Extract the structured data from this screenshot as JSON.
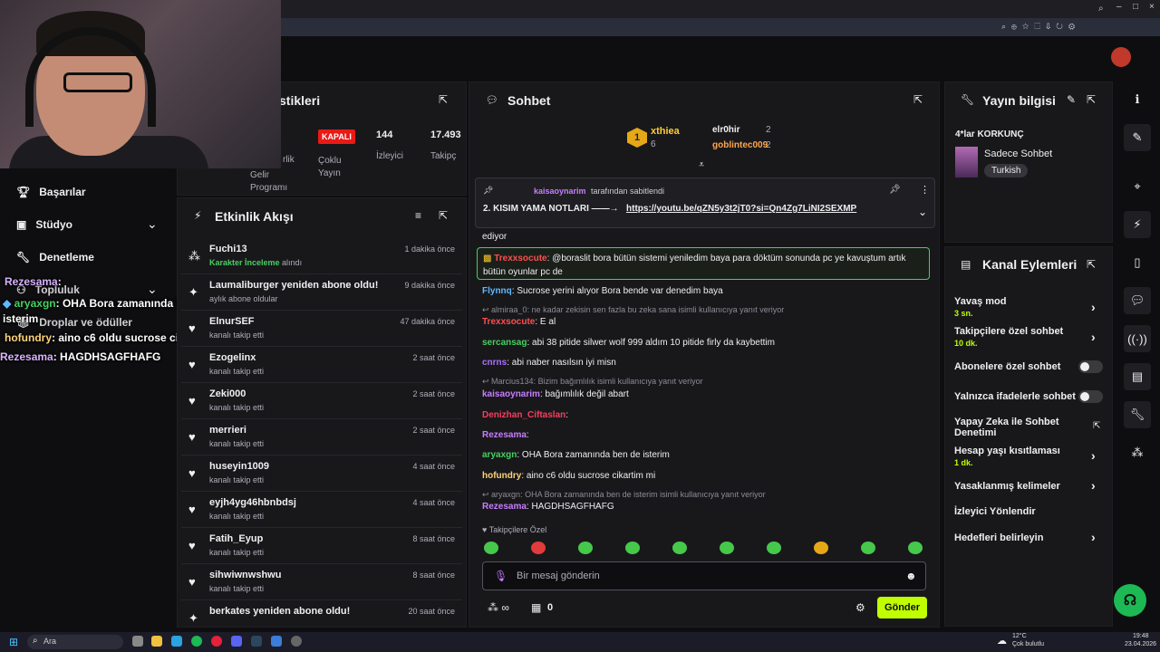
{
  "stats": {
    "title_fragment": "stikleri",
    "col1_top": "rlik",
    "col1_bottom": "Gelir Programı",
    "badge": "KAPALI",
    "multi_label": "Çoklu Yayın",
    "viewers_value": "144",
    "viewers_label": "İzleyici",
    "followers_value": "17.493",
    "followers_label": "Takipç"
  },
  "left_nav": {
    "items": [
      {
        "label": "Başarılar",
        "icon": "trophy-icon"
      },
      {
        "label": "Stüdyo",
        "icon": "studio-icon"
      },
      {
        "label": "Denetleme",
        "icon": "wrench-icon"
      },
      {
        "label": "Topluluk",
        "icon": "community-icon"
      },
      {
        "label": "Droplar ve ödüller",
        "icon": "gift-icon"
      }
    ]
  },
  "overlay_chat": [
    {
      "user": "Rezesama",
      "text": ":"
    },
    {
      "user": "aryaxgn",
      "text": ": OHA Bora zamanında ben de isterim"
    },
    {
      "user": "hofundry",
      "text": ": aino c6 oldu sucrose cikartim mi"
    },
    {
      "user": "Rezesama",
      "text": ": HAGDHSAGFHAFG"
    }
  ],
  "activity": {
    "title": "Etkinlik Akışı",
    "items": [
      {
        "name": "Fuchi13",
        "sub_green": "Karakter İnceleme",
        "sub": " alındı",
        "time": "1 dakika önce",
        "icon": "points-icon"
      },
      {
        "name": "Laumaliburger yeniden abone oldu!",
        "sub": "aylık abone oldular",
        "time": "9 dakika önce",
        "icon": "star-icon"
      },
      {
        "name": "ElnurSEF",
        "sub": "kanalı takip etti",
        "time": "47 dakika önce",
        "icon": "heart-icon"
      },
      {
        "name": "Ezogelinx",
        "sub": "kanalı takip etti",
        "time": "2 saat önce",
        "icon": "heart-icon"
      },
      {
        "name": "Zeki000",
        "sub": "kanalı takip etti",
        "time": "2 saat önce",
        "icon": "heart-icon"
      },
      {
        "name": "merrieri",
        "sub": "kanalı takip etti",
        "time": "2 saat önce",
        "icon": "heart-icon"
      },
      {
        "name": "huseyin1009",
        "sub": "kanalı takip etti",
        "time": "4 saat önce",
        "icon": "heart-icon"
      },
      {
        "name": "eyjh4yg46hbnbdsj",
        "sub": "kanalı takip etti",
        "time": "4 saat önce",
        "icon": "heart-icon"
      },
      {
        "name": "Fatih_Eyup",
        "sub": "kanalı takip etti",
        "time": "8 saat önce",
        "icon": "heart-icon"
      },
      {
        "name": "sihwiwnwshwu",
        "sub": "kanalı takip etti",
        "time": "8 saat önce",
        "icon": "heart-icon"
      },
      {
        "name": "berkates yeniden abone oldu!",
        "sub": "",
        "time": "20 saat önce",
        "icon": "star-icon"
      }
    ]
  },
  "chat": {
    "title": "Sohbet",
    "leaderboard": {
      "rank": "1",
      "first_name": "xthiea",
      "first_count": "6",
      "second_name": "elr0hir",
      "second_count": "2",
      "third_name": "goblintec009",
      "third_count": "2"
    },
    "pinned": {
      "by_user": "kaisaoynarim",
      "by_text": "tarafından sabitlendi",
      "message": "2. KISIM YAMA NOTLARI ——→",
      "link": "https://youtu.be/qZN5y3t2jT0?si=Qn4Zg7LiNI2SEXMP"
    },
    "partial_line": "ediyor",
    "highlight": {
      "user": "Trexxsocute",
      "text": ": @boraslit bora bütün sistemi yeniledim baya para döktüm sonunda pc ye kavuştum artık bütün oyunlar pc de"
    },
    "messages": [
      {
        "type": "msg",
        "user": "Flynnq",
        "color": "#5fb8ff",
        "text": ": Sucrose yerini alıyor Bora bende var denedim baya"
      },
      {
        "type": "reply",
        "text": "almiraa_0: ne kadar zekisin sen fazla bu zeka sana isimli kullanıcıya yanıt veriyor"
      },
      {
        "type": "msg",
        "user": "Trexxsocute",
        "color": "#ff4f4f",
        "text": ": E al"
      },
      {
        "type": "msg",
        "user": "sercansag",
        "color": "#46d160",
        "text": ": abi 38 pitide silwer wolf 999 aldım 10 pitide firly da kaybettim"
      },
      {
        "type": "msg",
        "user": "cnrns",
        "color": "#a970ff",
        "text": ": abi naber nasılsın iyi misn"
      },
      {
        "type": "reply",
        "text": "Marcius134: Bizim bağımlılık isimli kullanıcıya yanıt veriyor"
      },
      {
        "type": "msg",
        "user": "kaisaoynarim",
        "color": "#c77dff",
        "text": ": bağımlılık değil abart"
      },
      {
        "type": "msg",
        "user": "Denizhan_Ciftaslan",
        "color": "#ff3b5c",
        "text": ":"
      },
      {
        "type": "msg",
        "user": "Rezesama",
        "color": "#c77dff",
        "text": ":"
      },
      {
        "type": "msg",
        "user": "aryaxgn",
        "color": "#46d160",
        "text": ": OHA Bora zamanında ben de isterim"
      },
      {
        "type": "msg",
        "user": "hofundry",
        "color": "#ffd37a",
        "text": ": aino c6 oldu sucrose cikartim mi"
      },
      {
        "type": "reply",
        "text": "aryaxgn: OHA Bora zamanında ben de isterim isimli kullanıcıya yanıt veriyor"
      },
      {
        "type": "msg",
        "user": "Rezesama",
        "color": "#c77dff",
        "text": ": HAGDHSAGFHAFG"
      }
    ],
    "followers_only": "Takipçilere Özel",
    "input_placeholder": "Bir mesaj gönderin",
    "points": "0",
    "send_label": "Gönder"
  },
  "stream_info": {
    "title": "Yayın bilgisi",
    "stream_title": "4*lar KORKUNÇ",
    "category": "Sadece Sohbet",
    "tag": "Turkish"
  },
  "channel_actions": {
    "title": "Kanal Eylemleri",
    "slow_mode": "Yavaş mod",
    "slow_value": "3 sn.",
    "followers_chat": "Takipçilere özel sohbet",
    "followers_value": "10 dk.",
    "subs_chat": "Abonelere özel sohbet",
    "emote_chat": "Yalnızca ifadelerle sohbet",
    "ai_mod": "Yapay Zeka ile Sohbet Denetimi",
    "age_restrict": "Hesap yaşı kısıtlaması",
    "age_value": "1 dk.",
    "blocked_words": "Yasaklanmış kelimeler",
    "redirect": "İzleyici Yönlendir",
    "goals": "Hedefleri belirleyin"
  },
  "taskbar": {
    "search": "Ara",
    "weather_temp": "12°C",
    "weather_text": "Çok bulutlu",
    "time": "19:48",
    "date": "23.04.2026"
  },
  "colors": {
    "accent": "#bfff00",
    "panel": "#18181b",
    "bg": "#0e0e10"
  }
}
